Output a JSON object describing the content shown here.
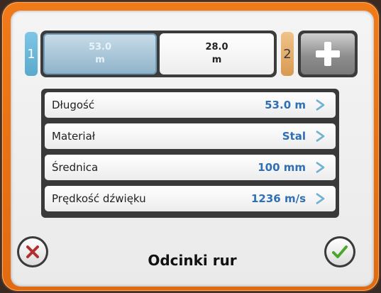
{
  "segments": {
    "number_1": "1",
    "number_2": "2",
    "seg1": {
      "value": "53.0",
      "unit": "m"
    },
    "seg2": {
      "value": "28.0",
      "unit": "m"
    }
  },
  "rows": [
    {
      "label": "Długość",
      "value": "53.0 m"
    },
    {
      "label": "Materiał",
      "value": "Stal"
    },
    {
      "label": "Średnica",
      "value": "100 mm"
    },
    {
      "label": "Prędkość dźwięku",
      "value": "1236 m/s"
    }
  ],
  "footer": {
    "title": "Odcinki rur"
  },
  "colors": {
    "frame": "#e26a10",
    "value_text": "#2f6fb3",
    "accent_blue": "#5aa9cc",
    "accent_tan": "#d89a52",
    "ok_green": "#4aa72c",
    "cancel_red": "#b03030"
  },
  "icons": {
    "add": "plus-icon",
    "cancel": "x-icon",
    "ok": "checkmark-icon",
    "chevron": "chevron-right-icon"
  }
}
